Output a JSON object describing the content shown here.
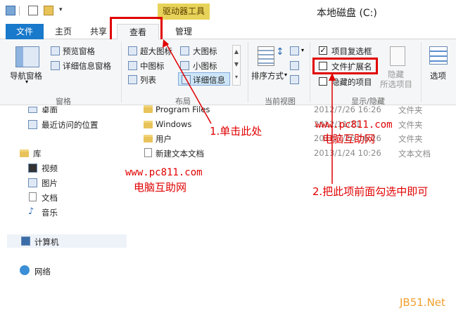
{
  "window": {
    "title": "本地磁盘 (C:)",
    "context_tab": "驱动器工具"
  },
  "tabs": [
    {
      "label": "文件"
    },
    {
      "label": "主页"
    },
    {
      "label": "共享"
    },
    {
      "label": "查看"
    },
    {
      "label": "管理"
    }
  ],
  "ribbon": {
    "panes": {
      "nav_pane": "导航窗格",
      "preview": "预览窗格",
      "details": "详细信息窗格",
      "group": "窗格"
    },
    "layout": {
      "xl_icons": "超大图标",
      "large_icons": "大图标",
      "medium_icons": "中图标",
      "small_icons": "小图标",
      "list": "列表",
      "details": "详细信息",
      "group": "布局"
    },
    "current_view": {
      "sort_by": "排序方式",
      "group": "当前视图"
    },
    "show_hide": {
      "item_checkboxes": "项目复选框",
      "file_extensions": "文件扩展名",
      "hidden_items": "隐藏的项目",
      "hide_selected_line1": "隐藏",
      "hide_selected_line2": "所选项目",
      "group": "显示/隐藏",
      "item_checkboxes_checked": true,
      "file_extensions_checked": false,
      "hidden_items_checked": false
    },
    "options": "选项"
  },
  "nav": {
    "desktop": "桌面",
    "recent": "最近访问的位置",
    "libraries": "库",
    "videos": "视频",
    "pictures": "图片",
    "documents": "文档",
    "music": "音乐",
    "computer": "计算机",
    "network": "网络"
  },
  "files": [
    {
      "name": "Program Files",
      "date": "2012/7/26 16:26",
      "type": "文件夹"
    },
    {
      "name": "Windows",
      "date": "2012/11/21",
      "type": "文件夹"
    },
    {
      "name": "用户",
      "date": "2012/7/26 16:26",
      "type": "文件夹"
    },
    {
      "name": "新建文本文档",
      "date": "2013/1/24 10:26",
      "type": "文本文档"
    }
  ],
  "annotations": {
    "step1": "1.单击此处",
    "step2": "2.把此项前面勾选中即可",
    "watermark_url": "www.pc811.com",
    "watermark_cn": "电脑互助网",
    "site_mark": "JB51.Net"
  },
  "colors": {
    "accent": "#1979ca",
    "annotation": "#e00000",
    "context_tab": "#e8d35a"
  }
}
